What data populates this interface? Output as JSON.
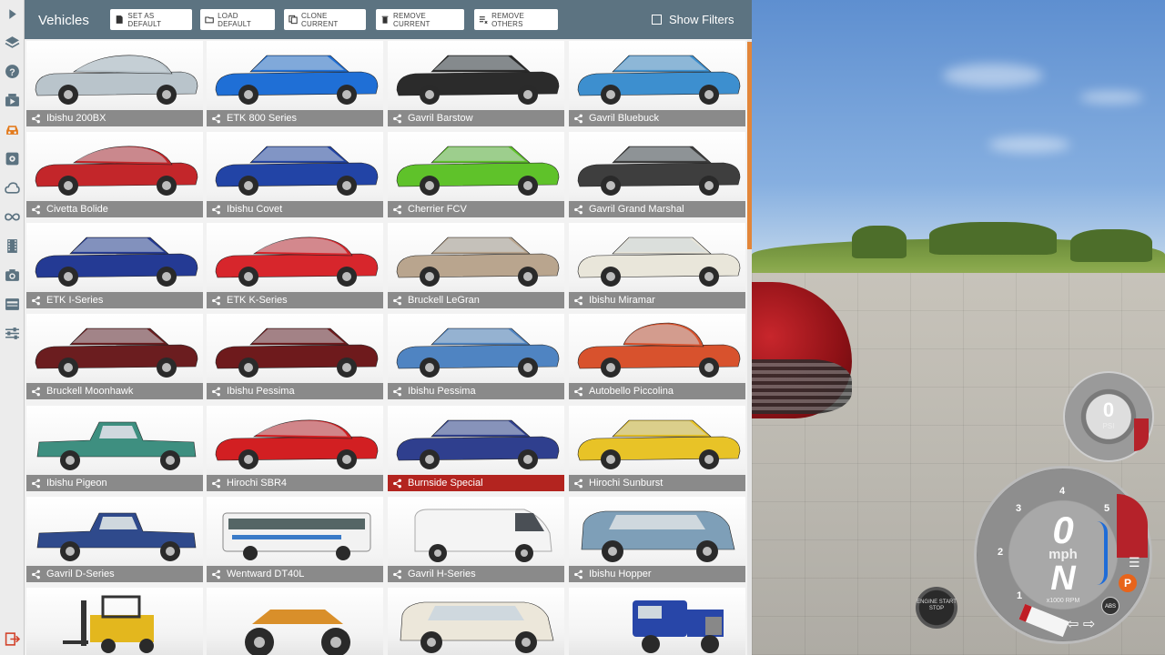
{
  "panel": {
    "title": "Vehicles",
    "buttons": {
      "set_default": "SET AS DEFAULT",
      "load_default": "LOAD DEFAULT",
      "clone_current": "CLONE CURRENT",
      "remove_current": "REMOVE CURRENT",
      "remove_others": "REMOVE OTHERS"
    },
    "show_filters": "Show Filters"
  },
  "vehicles": [
    {
      "name": "Ibishu 200BX",
      "color": "#b9c4cb",
      "body": "coupe"
    },
    {
      "name": "ETK 800 Series",
      "color": "#1f6fd6",
      "body": "wagon"
    },
    {
      "name": "Gavril Barstow",
      "color": "#2b2b2b",
      "body": "muscle"
    },
    {
      "name": "Gavril Bluebuck",
      "color": "#3d8fcf",
      "body": "sedan-old"
    },
    {
      "name": "Civetta Bolide",
      "color": "#c3262a",
      "body": "coupe"
    },
    {
      "name": "Ibishu Covet",
      "color": "#2244a6",
      "body": "hatch"
    },
    {
      "name": "Cherrier FCV",
      "color": "#5fc22a",
      "body": "hatch"
    },
    {
      "name": "Gavril Grand Marshal",
      "color": "#3e3e3e",
      "body": "sedan"
    },
    {
      "name": "ETK I-Series",
      "color": "#243a94",
      "body": "sedan"
    },
    {
      "name": "ETK K-Series",
      "color": "#d7262c",
      "body": "coupe"
    },
    {
      "name": "Bruckell LeGran",
      "color": "#b9a58e",
      "body": "sedan"
    },
    {
      "name": "Ibishu Miramar",
      "color": "#e9e6da",
      "body": "sedan-old"
    },
    {
      "name": "Bruckell Moonhawk",
      "color": "#6b1d1f",
      "body": "muscle"
    },
    {
      "name": "Ibishu Pessima",
      "color": "#6e1a1c",
      "body": "sedan"
    },
    {
      "name": "Ibishu Pessima",
      "color": "#4f84c2",
      "body": "sedan"
    },
    {
      "name": "Autobello Piccolina",
      "color": "#d8522d",
      "body": "small"
    },
    {
      "name": "Ibishu Pigeon",
      "color": "#3e8f80",
      "body": "pickup-small"
    },
    {
      "name": "Hirochi SBR4",
      "color": "#d21f22",
      "body": "coupe"
    },
    {
      "name": "Burnside Special",
      "color": "#2f3f8e",
      "body": "sedan-old"
    },
    {
      "name": "Hirochi Sunburst",
      "color": "#e8c327",
      "body": "hatch"
    },
    {
      "name": "Gavril D-Series",
      "color": "#2f4a8c",
      "body": "pickup"
    },
    {
      "name": "Wentward DT40L",
      "color": "#f2f2f2",
      "body": "bus"
    },
    {
      "name": "Gavril H-Series",
      "color": "#f4f4f4",
      "body": "van"
    },
    {
      "name": "Ibishu Hopper",
      "color": "#7e9fb8",
      "body": "jeep"
    },
    {
      "name": "",
      "color": "#e3b71e",
      "body": "forklift"
    },
    {
      "name": "",
      "color": "#d98f2a",
      "body": "monster"
    },
    {
      "name": "",
      "color": "#ece7da",
      "body": "suv"
    },
    {
      "name": "",
      "color": "#2846a8",
      "body": "semi"
    }
  ],
  "selected_vehicle": "Burnside Special",
  "hud": {
    "boost_value": "0",
    "boost_unit": "PSI",
    "speed_value": "0",
    "speed_unit": "mph",
    "gear": "N",
    "rpm_label": "x1000 RPM",
    "tach_ticks": [
      "1",
      "2",
      "3",
      "4",
      "5"
    ],
    "parking_badge": "P",
    "abs_badge": "ABS",
    "engine_button": "ENGINE START STOP"
  },
  "rail_icons": [
    "play-icon",
    "layers-icon",
    "help-icon",
    "media-icon",
    "car-icon",
    "settings-icon",
    "cloud-icon",
    "infinity-icon",
    "film-icon",
    "camera-icon",
    "card-icon",
    "sliders-icon",
    "exit-icon"
  ]
}
